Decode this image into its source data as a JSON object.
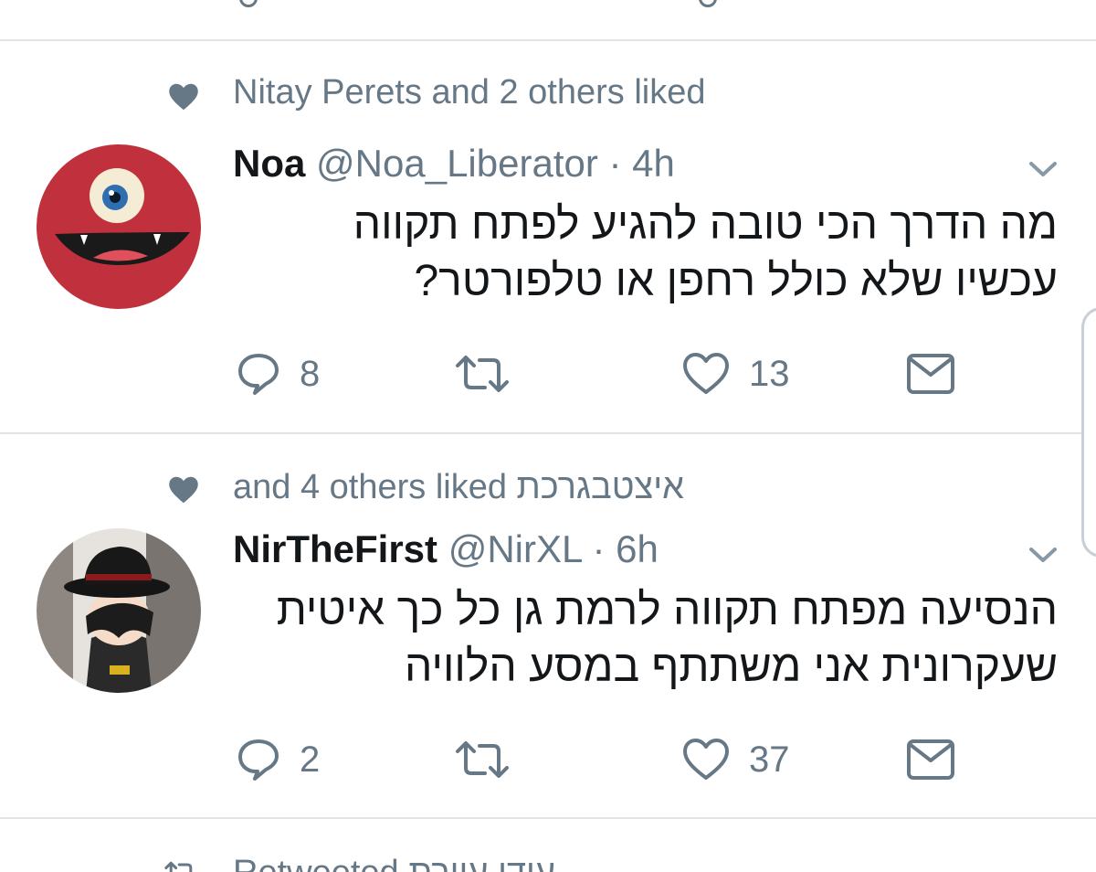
{
  "colors": {
    "text": "#14171a",
    "secondary": "#667786",
    "divider": "#dfe4e8",
    "background": "#ffffff"
  },
  "tweets": [
    {
      "social_context": "Nitay Perets and 2 others liked",
      "social_icon": "heart-filled-icon",
      "display_name": "Noa",
      "handle_time": "@Noa_Liberator · 4h",
      "avatar": "red-monster-avatar",
      "text_line1": "מה הדרך הכי טובה להגיע לפתח תקווה",
      "text_line2": "עכשיו שלא כולל רחפן או טלפורטר?",
      "reply_count": "8",
      "like_count": "13"
    },
    {
      "social_context": "and 4 others liked איצטבגרכת",
      "social_icon": "heart-filled-icon",
      "display_name": "NirTheFirst",
      "handle_time": "@NirXL · 6h",
      "avatar": "chibi-hat-avatar",
      "text_line1": "הנסיעה מפתח תקווה לרמת גן כל כך איטית",
      "text_line2": "שעקרונית אני משתתף במסע הלוויה",
      "reply_count": "2",
      "like_count": "37"
    }
  ],
  "next_item": {
    "context": "Retweeted עידו עוורת",
    "icon": "retweet-icon"
  }
}
